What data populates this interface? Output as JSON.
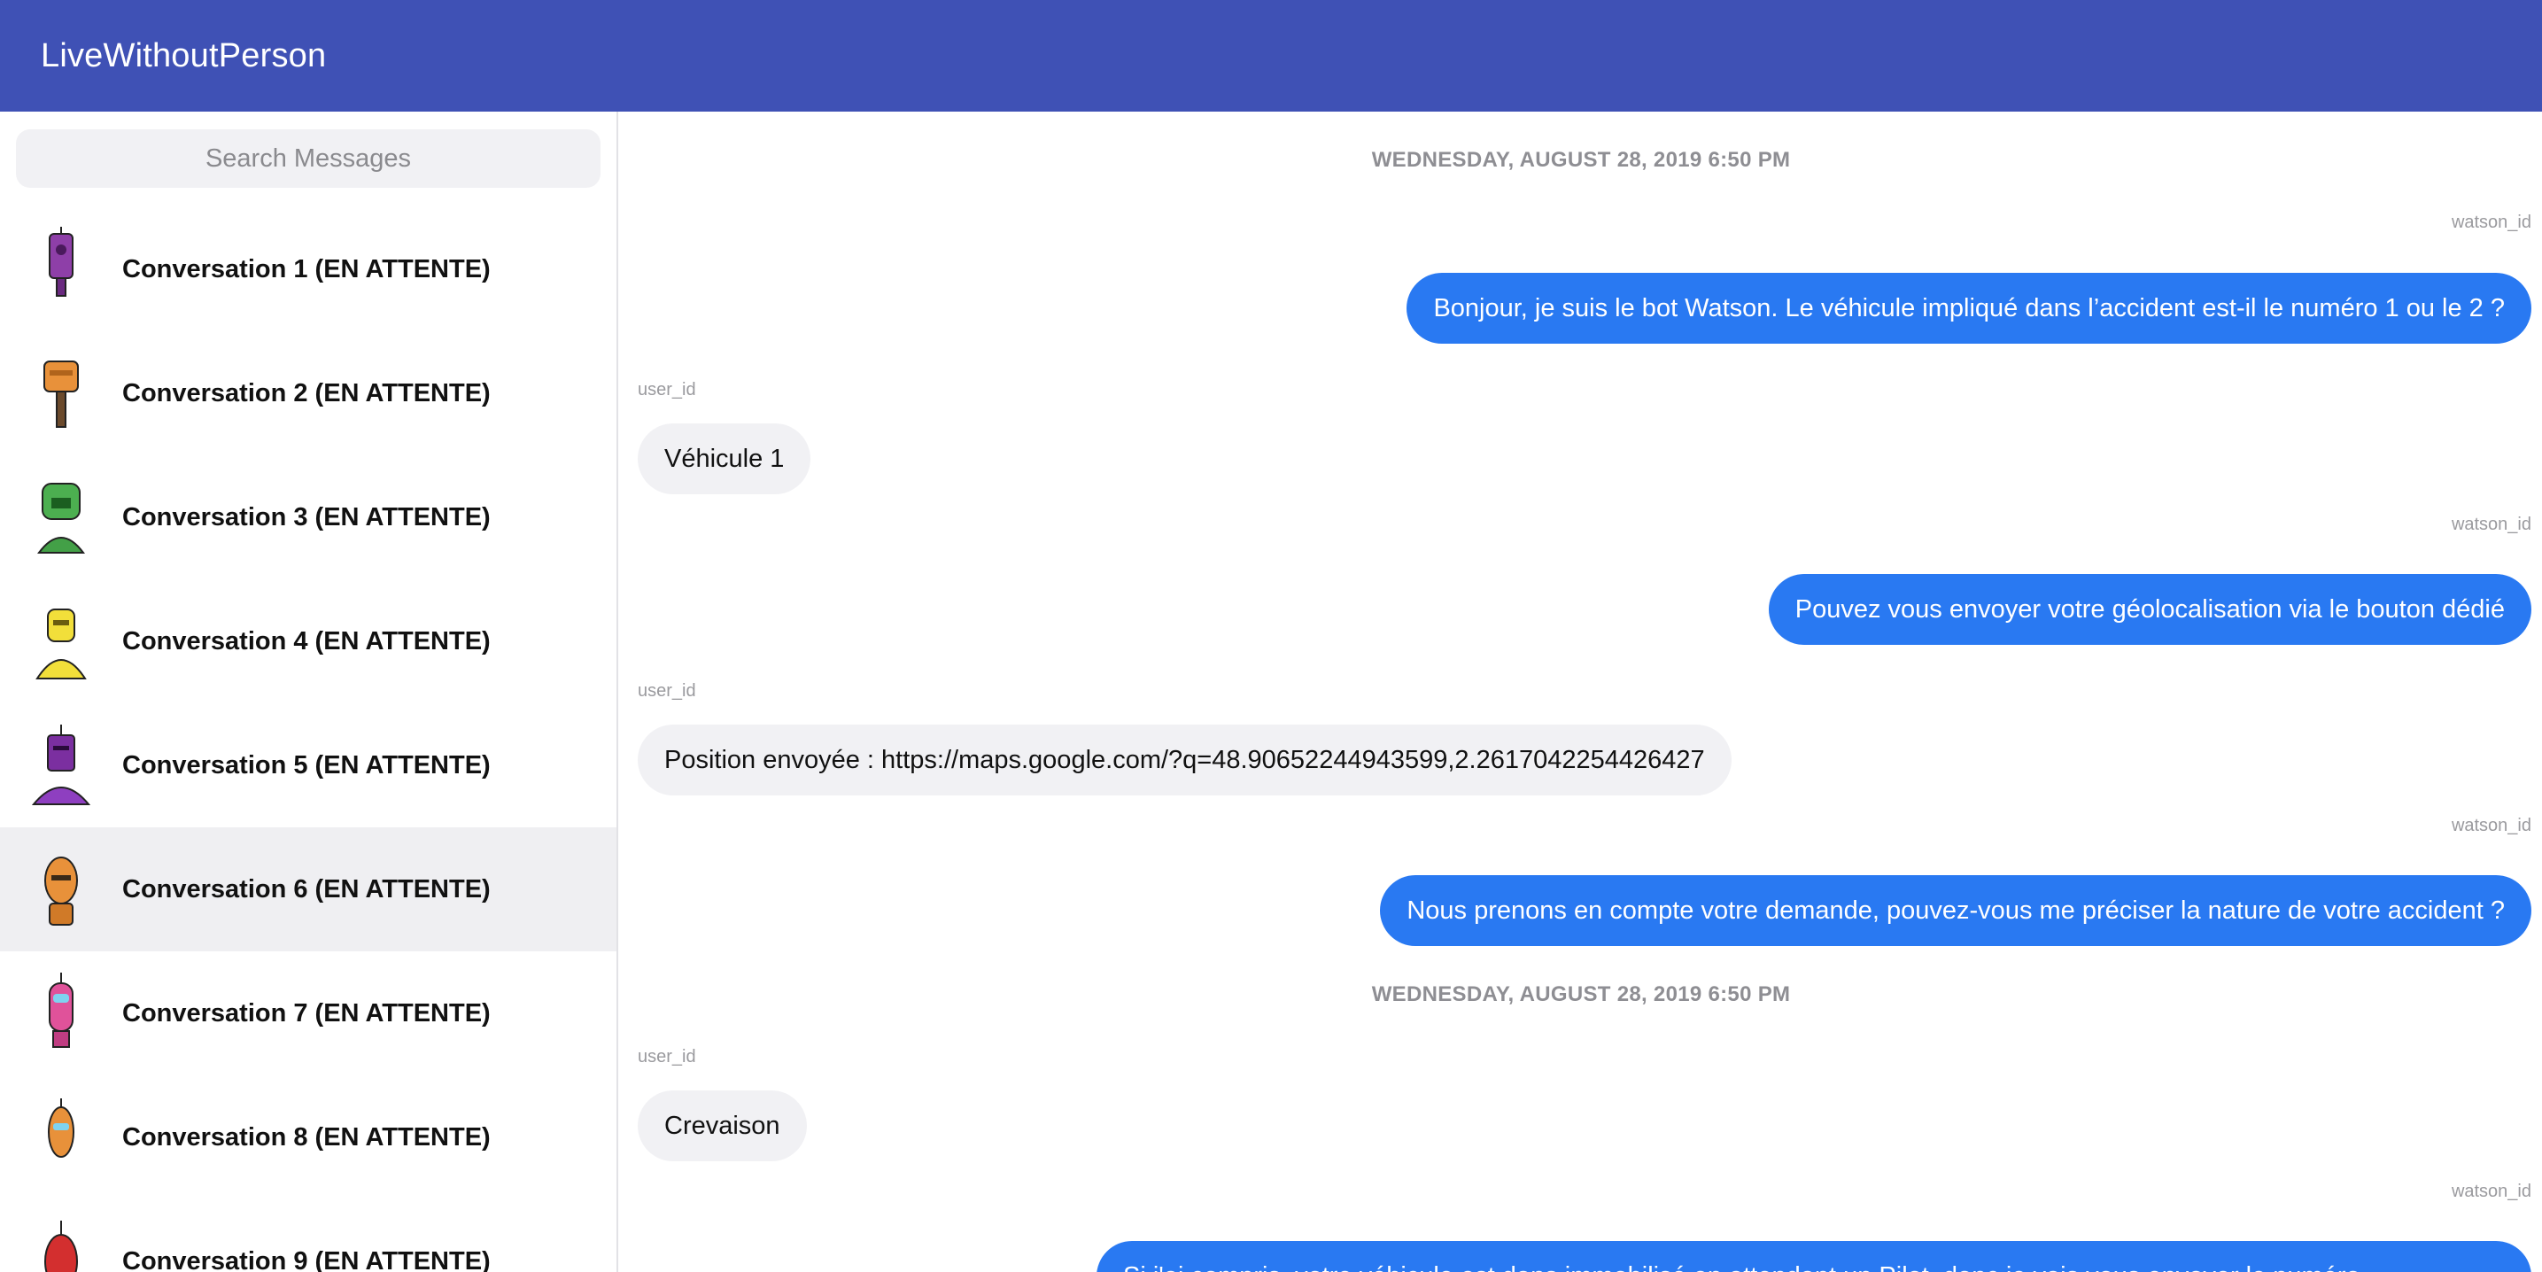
{
  "header": {
    "title": "LiveWithoutPerson",
    "color": "#3f51b5"
  },
  "sidebar": {
    "search_placeholder": "Search Messages",
    "conversations": [
      {
        "label": "Conversation 1 (EN ATTENTE)",
        "avatar": "purple-robot-icon",
        "color": "#8e3fa8"
      },
      {
        "label": "Conversation 2 (EN ATTENTE)",
        "avatar": "orange-robot-icon",
        "color": "#e8913a"
      },
      {
        "label": "Conversation 3 (EN ATTENTE)",
        "avatar": "green-robot-icon",
        "color": "#4caf50"
      },
      {
        "label": "Conversation 4 (EN ATTENTE)",
        "avatar": "yellow-robot-icon",
        "color": "#f2df3a"
      },
      {
        "label": "Conversation 5 (EN ATTENTE)",
        "avatar": "violet-robot-icon",
        "color": "#7b2fa0"
      },
      {
        "label": "Conversation 6 (EN ATTENTE)",
        "avatar": "orange-robot-icon",
        "color": "#e8913a",
        "selected": true
      },
      {
        "label": "Conversation 7 (EN ATTENTE)",
        "avatar": "pink-robot-icon",
        "color": "#e0529a"
      },
      {
        "label": "Conversation 8 (EN ATTENTE)",
        "avatar": "orange-robot-icon",
        "color": "#e8913a"
      },
      {
        "label": "Conversation 9 (EN ATTENTE)",
        "avatar": "red-robot-icon",
        "color": "#d32f2f"
      }
    ]
  },
  "chat": {
    "date_1": "WEDNESDAY, AUGUST 28, 2019 6:50 PM",
    "date_2": "WEDNESDAY, AUGUST 28, 2019 6:50 PM",
    "bot_sender": "watson_id",
    "user_sender": "user_id",
    "messages": [
      "Bonjour, je suis le bot Watson. Le véhicule impliqué dans l’accident est-il le numéro 1 ou le 2 ?",
      "Véhicule 1",
      "Pouvez vous envoyer votre géolocalisation via le bouton dédié",
      "Position envoyée : https://maps.google.com/?q=48.90652244943599,2.2617042254426427",
      "Nous prenons en compte votre demande, pouvez-vous me préciser la nature de votre accident ?",
      "Crevaison",
      "Si j'ai compris, votre véhicule est dans immobilisé en attendant un Pilot, donc je vais vous envoyer le numéro"
    ],
    "outgoing_color": "#2979f2",
    "incoming_color": "#f1f1f4"
  }
}
